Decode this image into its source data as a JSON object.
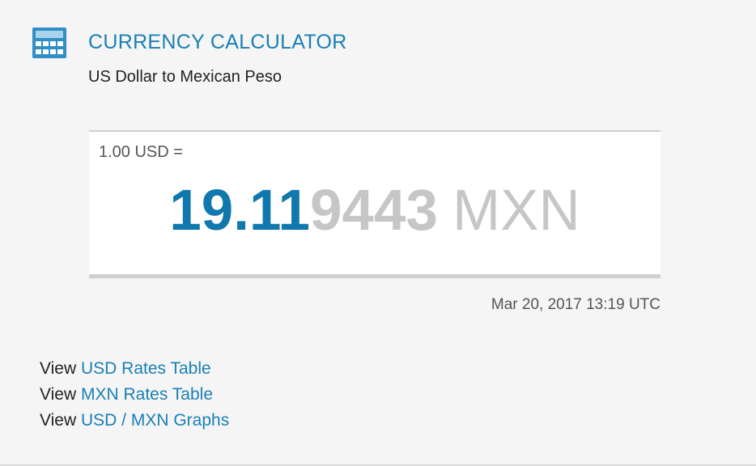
{
  "header": {
    "title": "CURRENCY CALCULATOR",
    "subtitle": "US Dollar to Mexican Peso",
    "icon": "calculator-icon",
    "accent_color": "#1a7fb5"
  },
  "conversion": {
    "base_amount": "1.00 USD =",
    "rate_major": "19.11",
    "rate_minor": "9443",
    "target_currency": "MXN",
    "highlight_color": "#0f78ad",
    "muted_color": "#c6c6c6"
  },
  "timestamp": "Mar 20, 2017 13:19 UTC",
  "links": [
    {
      "prefix": "View",
      "label": "USD Rates Table"
    },
    {
      "prefix": "View",
      "label": "MXN Rates Table"
    },
    {
      "prefix": "View",
      "label": "USD / MXN Graphs"
    }
  ]
}
